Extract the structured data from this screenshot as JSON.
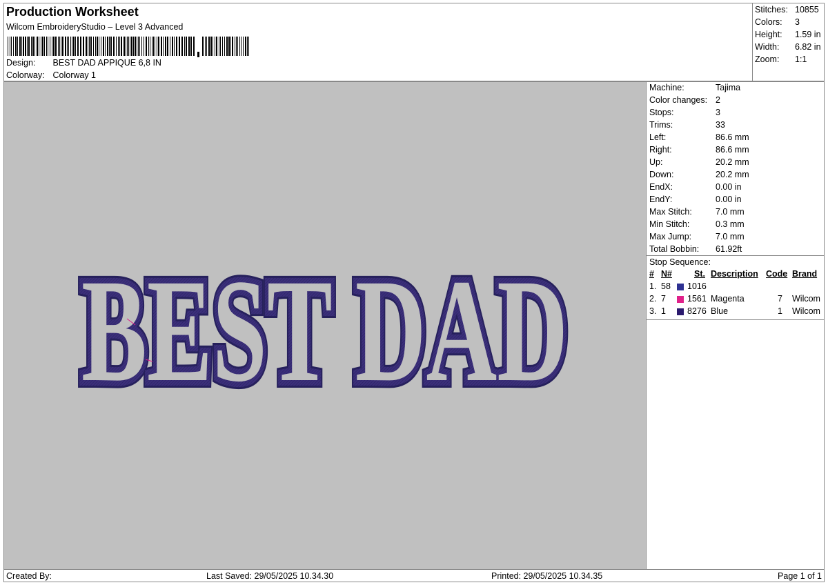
{
  "header": {
    "title": "Production Worksheet",
    "subtitle": "Wilcom EmbroideryStudio – Level 3 Advanced",
    "design_label": "Design:",
    "design_value": "BEST DAD APPIQUE 6,8 IN",
    "colorway_label": "Colorway:",
    "colorway_value": "Colorway 1"
  },
  "summary": [
    {
      "label": "Stitches:",
      "value": "10855"
    },
    {
      "label": "Colors:",
      "value": "3"
    },
    {
      "label": "Height:",
      "value": "1.59 in"
    },
    {
      "label": "Width:",
      "value": "6.82 in"
    },
    {
      "label": "Zoom:",
      "value": "1:1"
    }
  ],
  "design_preview": {
    "text": "BEST DAD",
    "fill_color": "#c0c0c0",
    "stitch_color": "#3b2f7a",
    "outline_color": "#26205c"
  },
  "machine": [
    {
      "label": "Machine:",
      "value": "Tajima"
    },
    {
      "label": "Color changes:",
      "value": "2"
    },
    {
      "label": "Stops:",
      "value": "3"
    },
    {
      "label": "Trims:",
      "value": "33"
    },
    {
      "label": "Left:",
      "value": "86.6 mm"
    },
    {
      "label": "Right:",
      "value": "86.6 mm"
    },
    {
      "label": "Up:",
      "value": "20.2 mm"
    },
    {
      "label": "Down:",
      "value": "20.2 mm"
    },
    {
      "label": "EndX:",
      "value": "0.00 in"
    },
    {
      "label": "EndY:",
      "value": "0.00 in"
    },
    {
      "label": "Max Stitch:",
      "value": "7.0 mm"
    },
    {
      "label": "Min Stitch:",
      "value": "0.3 mm"
    },
    {
      "label": "Max Jump:",
      "value": "7.0 mm"
    },
    {
      "label": "Total Bobbin:",
      "value": "61.92ft"
    }
  ],
  "stop_sequence": {
    "title": "Stop Sequence:",
    "headers": {
      "num": "#",
      "n": "N#",
      "st": "St.",
      "desc": "Description",
      "code": "Code",
      "brand": "Brand"
    },
    "rows": [
      {
        "num": "1.",
        "n": "58",
        "color": "#2e3192",
        "st": "1016",
        "desc": "",
        "code": "",
        "brand": ""
      },
      {
        "num": "2.",
        "n": "7",
        "color": "#e0218a",
        "st": "1561",
        "desc": "Magenta",
        "code": "7",
        "brand": "Wilcom"
      },
      {
        "num": "3.",
        "n": "1",
        "color": "#2b1a6e",
        "st": "8276",
        "desc": "Blue",
        "code": "1",
        "brand": "Wilcom"
      }
    ]
  },
  "footer": {
    "created_by": "Created By:",
    "last_saved": "Last Saved: 29/05/2025 10.34.30",
    "printed": "Printed: 29/05/2025 10.34.35",
    "page": "Page 1 of 1"
  }
}
